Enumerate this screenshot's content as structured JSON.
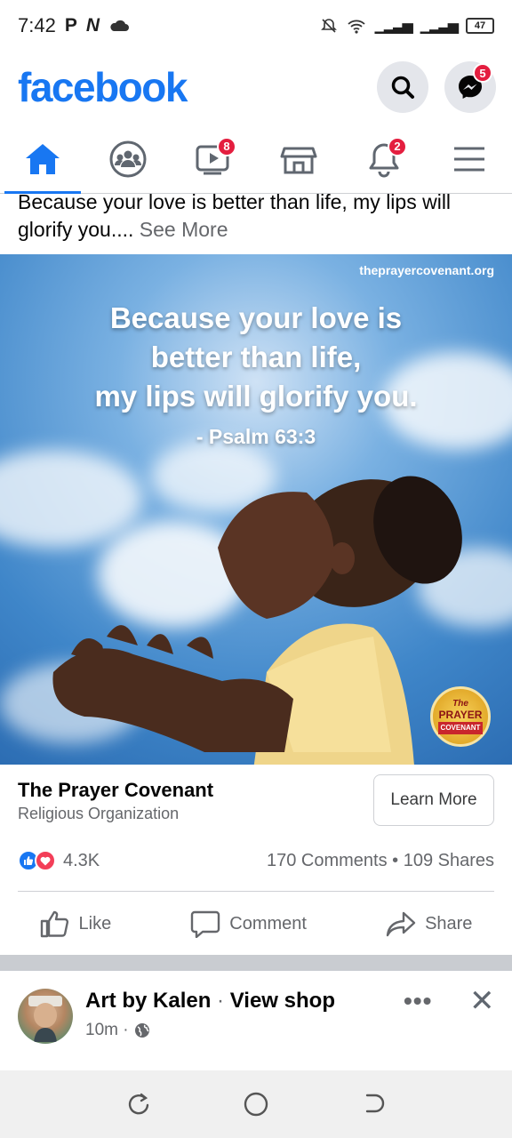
{
  "status_bar": {
    "time": "7:42",
    "left_icons": [
      "P",
      "N",
      "cloud-icon"
    ],
    "battery": "47"
  },
  "header": {
    "logo": "facebook",
    "messenger_badge": "5"
  },
  "nav": {
    "tabs": [
      {
        "name": "home",
        "badge": ""
      },
      {
        "name": "groups",
        "badge": ""
      },
      {
        "name": "watch",
        "badge": "8"
      },
      {
        "name": "marketplace",
        "badge": ""
      },
      {
        "name": "notifications",
        "badge": "2"
      },
      {
        "name": "menu",
        "badge": ""
      }
    ]
  },
  "post": {
    "caption": "Because your love is better than life, my lips will glorify you....",
    "see_more": "See More",
    "image": {
      "site": "theprayercovenant.org",
      "quote_line1": "Because your love is",
      "quote_line2": "better than life,",
      "quote_line3": "my lips will glorify you.",
      "reference": "- Psalm 63:3",
      "seal_line1": "The",
      "seal_line2": "PRAYER",
      "seal_line3": "COVENANT"
    },
    "page_name": "The Prayer Covenant",
    "page_category": "Religious Organization",
    "cta": "Learn More",
    "reaction_count": "4.3K",
    "comments": "170 Comments",
    "shares": "109 Shares",
    "actions": {
      "like": "Like",
      "comment": "Comment",
      "share": "Share"
    }
  },
  "next_post": {
    "author": "Art by Kalen",
    "separator": "·",
    "view_shop": "View shop",
    "time": "10m ·"
  },
  "colors": {
    "brand": "#1877f2",
    "badge": "#e41e3f",
    "secondary_text": "#65676b"
  }
}
